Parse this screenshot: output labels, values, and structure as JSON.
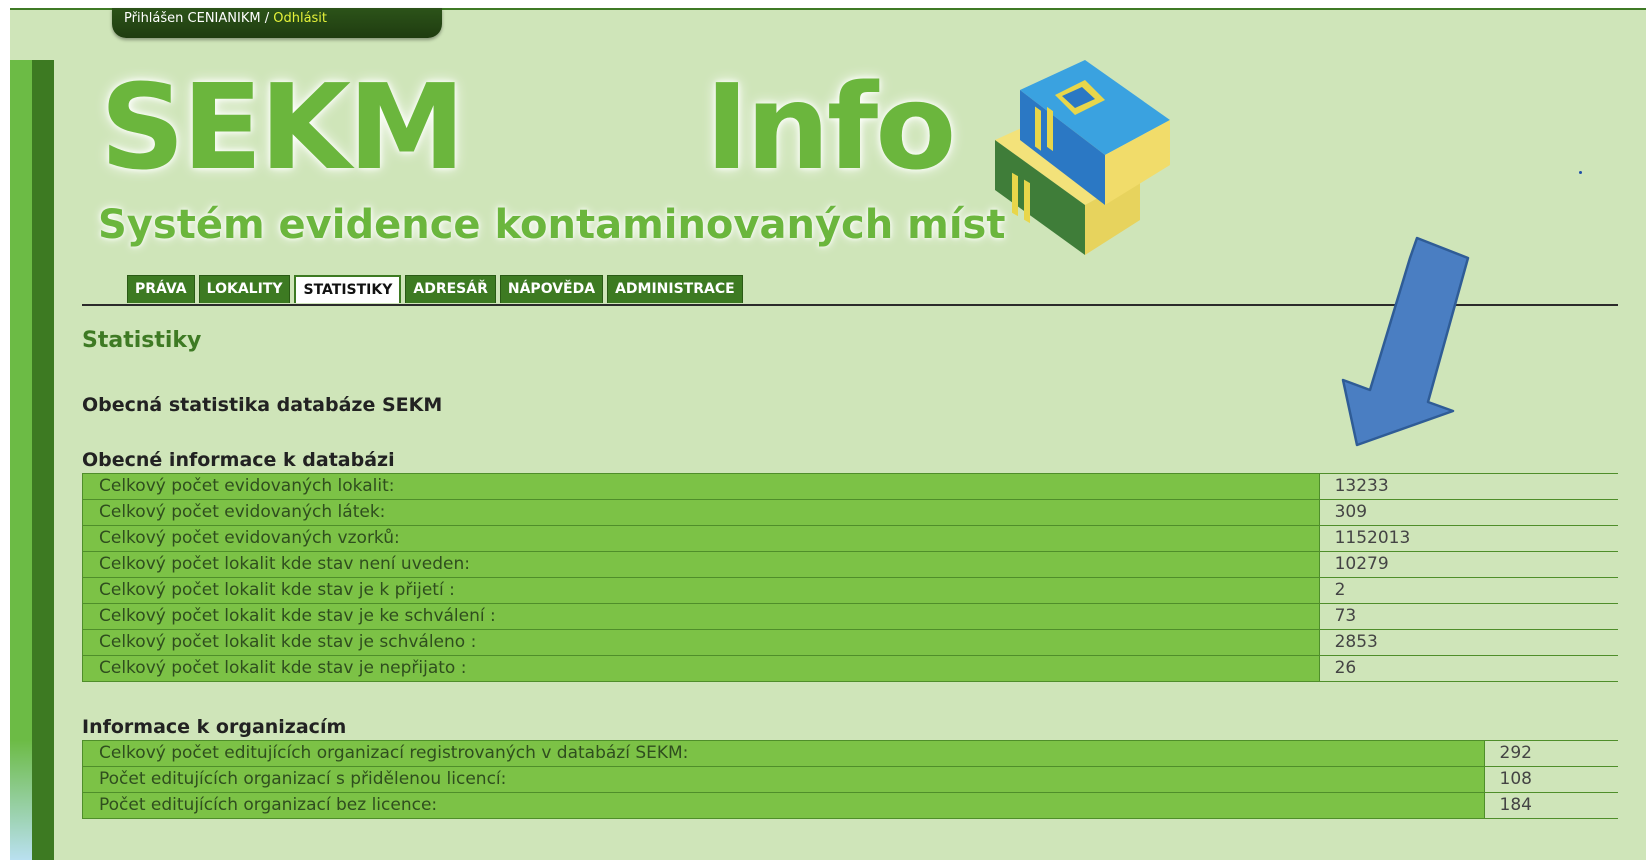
{
  "session": {
    "logged_in_text": "Přihlášen CENIANIKM /",
    "logout_label": "Odhlásit"
  },
  "logo": {
    "brand": "SEKM",
    "brand_suffix": "Info",
    "subtitle": "Systém evidence kontaminovaných míst"
  },
  "nav": {
    "tabs": [
      {
        "label": "PRÁVA",
        "active": false
      },
      {
        "label": "LOKALITY",
        "active": false
      },
      {
        "label": "STATISTIKY",
        "active": true
      },
      {
        "label": "ADRESÁŘ",
        "active": false
      },
      {
        "label": "NÁPOVĚDA",
        "active": false
      },
      {
        "label": "ADMINISTRACE",
        "active": false
      }
    ]
  },
  "main": {
    "page_title": "Statistiky",
    "section_title": "Obecná statistika databáze SEKM",
    "groups": [
      {
        "title": "Obecné informace k databázi",
        "rows": [
          {
            "label": "Celkový počet evidovaných lokalit:",
            "value": "13233"
          },
          {
            "label": "Celkový počet evidovaných látek:",
            "value": "309"
          },
          {
            "label": "Celkový počet evidovaných vzorků:",
            "value": "1152013"
          },
          {
            "label": "Celkový počet lokalit kde stav není uveden:",
            "value": "10279"
          },
          {
            "label": "Celkový počet lokalit kde stav je k přijetí :",
            "value": "2"
          },
          {
            "label": "Celkový počet lokalit kde stav je ke schválení :",
            "value": "73"
          },
          {
            "label": "Celkový počet lokalit kde stav je schváleno :",
            "value": "2853"
          },
          {
            "label": "Celkový počet lokalit kde stav je nepřijato :",
            "value": "26"
          }
        ]
      },
      {
        "title": "Informace k organizacím",
        "rows": [
          {
            "label": "Celkový počet editujících organizací registrovaných v databází SEKM:",
            "value": "292"
          },
          {
            "label": "Počet editujících organizací s přidělenou licencí:",
            "value": "108"
          },
          {
            "label": "Počet editujících organizací bez licence:",
            "value": "184"
          }
        ]
      }
    ]
  },
  "colors": {
    "page_bg": "#cfe5b9",
    "brand_green": "#6bb63d",
    "dark_green": "#3d7a22",
    "table_green": "#7cc246",
    "annotation_arrow": "#4a7ec2"
  },
  "icons": {
    "logo_books": "books-icon",
    "annotation": "down-left-arrow-icon"
  }
}
